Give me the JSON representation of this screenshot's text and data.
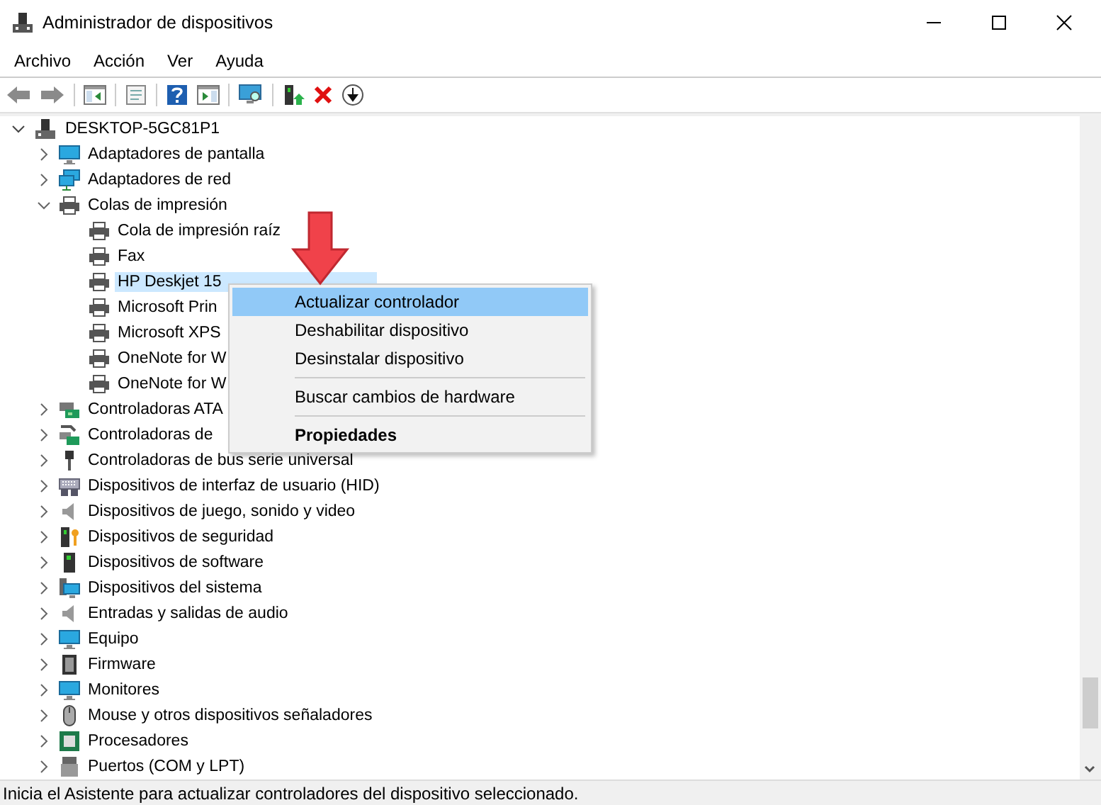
{
  "window": {
    "title": "Administrador de dispositivos"
  },
  "menu_bar": [
    "Archivo",
    "Acción",
    "Ver",
    "Ayuda"
  ],
  "tree": {
    "label": "DESKTOP-5GC81P1",
    "expanded": true,
    "children": [
      {
        "label": "Adaptadores de pantalla",
        "expanded": false
      },
      {
        "label": "Adaptadores de red",
        "expanded": false
      },
      {
        "label": "Colas de impresión",
        "expanded": true,
        "children": [
          {
            "label": "Cola de impresión raíz",
            "selected": false
          },
          {
            "label": "Fax",
            "selected": false
          },
          {
            "label": "HP Deskjet 15",
            "selected": true
          },
          {
            "label": "Microsoft Prin",
            "selected": false
          },
          {
            "label": "Microsoft XPS",
            "selected": false
          },
          {
            "label": "OneNote for W",
            "selected": false
          },
          {
            "label": "OneNote for W",
            "selected": false
          }
        ]
      },
      {
        "label": "Controladoras ATA",
        "expanded": false
      },
      {
        "label": "Controladoras de",
        "expanded": false
      },
      {
        "label": "Controladoras de bus serie universal",
        "expanded": false
      },
      {
        "label": "Dispositivos de interfaz de usuario (HID)",
        "expanded": false
      },
      {
        "label": "Dispositivos de juego, sonido y video",
        "expanded": false
      },
      {
        "label": "Dispositivos de seguridad",
        "expanded": false
      },
      {
        "label": "Dispositivos de software",
        "expanded": false
      },
      {
        "label": "Dispositivos del sistema",
        "expanded": false
      },
      {
        "label": "Entradas y salidas de audio",
        "expanded": false
      },
      {
        "label": "Equipo",
        "expanded": false
      },
      {
        "label": "Firmware",
        "expanded": false
      },
      {
        "label": "Monitores",
        "expanded": false
      },
      {
        "label": "Mouse y otros dispositivos señaladores",
        "expanded": false
      },
      {
        "label": "Procesadores",
        "expanded": false
      },
      {
        "label": "Puertos (COM y LPT)",
        "expanded": false
      }
    ]
  },
  "context_menu": [
    {
      "kind": "item",
      "label": "Actualizar controlador",
      "selected": true,
      "default": false
    },
    {
      "kind": "item",
      "label": "Deshabilitar dispositivo",
      "selected": false,
      "default": false
    },
    {
      "kind": "item",
      "label": "Desinstalar dispositivo",
      "selected": false,
      "default": false
    },
    {
      "kind": "separator"
    },
    {
      "kind": "item",
      "label": "Buscar cambios de hardware",
      "selected": false,
      "default": false
    },
    {
      "kind": "separator"
    },
    {
      "kind": "item",
      "label": "Propiedades",
      "selected": false,
      "default": true
    }
  ],
  "status_bar": "Inicia el Asistente para actualizar controladores del dispositivo seleccionado."
}
